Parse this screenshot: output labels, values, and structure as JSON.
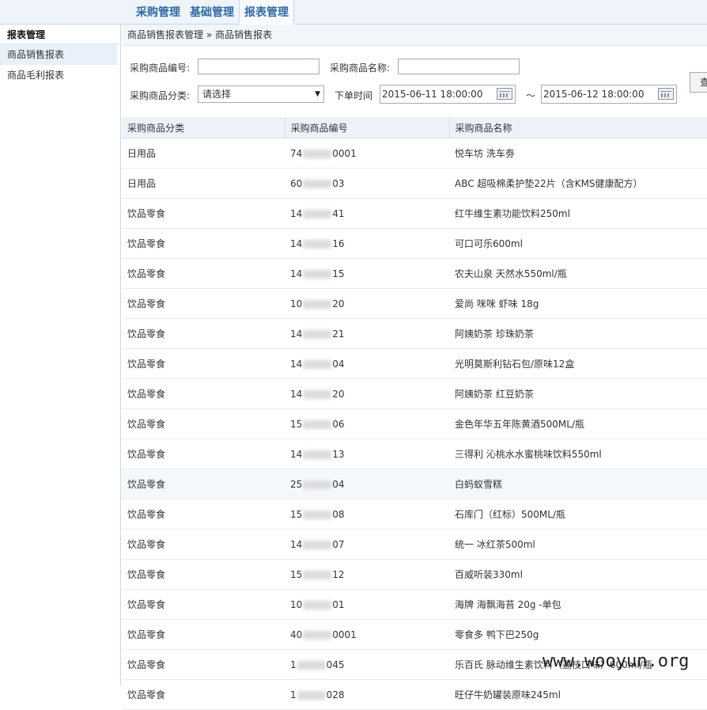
{
  "topnav": {
    "tabs": [
      {
        "label": "采购管理"
      },
      {
        "label": "基础管理"
      },
      {
        "label": "报表管理"
      }
    ]
  },
  "sidebar": {
    "title": "报表管理",
    "items": [
      {
        "label": "商品销售报表"
      },
      {
        "label": "商品毛利报表"
      }
    ]
  },
  "breadcrumb": "商品销售报表管理 » 商品销售报表",
  "form": {
    "code_label": "采购商品编号:",
    "code_value": "",
    "name_label": "采购商品名称:",
    "name_value": "",
    "category_label": "采购商品分类:",
    "category_value": "请选择",
    "time_label": "下单时间",
    "start_time": "2015-06-11 18:00:00",
    "tilde": "～",
    "end_time": "2015-06-12 18:00:00",
    "query_label": "查"
  },
  "table": {
    "headers": [
      "采购商品分类",
      "采购商品编号",
      "采购商品名称"
    ],
    "rows": [
      {
        "category": "日用品",
        "code_pre": "74",
        "code_suf": "0001",
        "name": "悦车坊 洗车劵"
      },
      {
        "category": "日用品",
        "code_pre": "60",
        "code_suf": "03",
        "name": "ABC 超吸棉柔护垫22片（含KMS健康配方）"
      },
      {
        "category": "饮品零食",
        "code_pre": "14",
        "code_suf": "41",
        "name": "红牛维生素功能饮料250ml"
      },
      {
        "category": "饮品零食",
        "code_pre": "14",
        "code_suf": "16",
        "name": "可口可乐600ml"
      },
      {
        "category": "饮品零食",
        "code_pre": "14",
        "code_suf": "15",
        "name": "农夫山泉 天然水550ml/瓶"
      },
      {
        "category": "饮品零食",
        "code_pre": "10",
        "code_suf": "20",
        "name": "爱尚 咪咪 虾味 18g"
      },
      {
        "category": "饮品零食",
        "code_pre": "14",
        "code_suf": "21",
        "name": "阿姨奶茶 珍珠奶茶"
      },
      {
        "category": "饮品零食",
        "code_pre": "14",
        "code_suf": "04",
        "name": "光明莫斯利钻石包/原味12盒"
      },
      {
        "category": "饮品零食",
        "code_pre": "14",
        "code_suf": "20",
        "name": "阿姨奶茶 红豆奶茶"
      },
      {
        "category": "饮品零食",
        "code_pre": "15",
        "code_suf": "06",
        "name": "金色年华五年陈黄酒500ML/瓶"
      },
      {
        "category": "饮品零食",
        "code_pre": "14",
        "code_suf": "13",
        "name": "三得利 沁桃水水蜜桃味饮料550ml"
      },
      {
        "category": "饮品零食",
        "code_pre": "25",
        "code_suf": "04",
        "name": "白蚂蚁雪糕"
      },
      {
        "category": "饮品零食",
        "code_pre": "15",
        "code_suf": "08",
        "name": "石库门（红标）500ML/瓶"
      },
      {
        "category": "饮品零食",
        "code_pre": "14",
        "code_suf": "07",
        "name": "统一 冰红茶500ml"
      },
      {
        "category": "饮品零食",
        "code_pre": "15",
        "code_suf": "12",
        "name": "百威听装330ml"
      },
      {
        "category": "饮品零食",
        "code_pre": "10",
        "code_suf": "01",
        "name": "海牌 海飘海苔 20g -单包"
      },
      {
        "category": "饮品零食",
        "code_pre": "40",
        "code_suf": "0001",
        "name": "零食多 鸭下巴250g"
      },
      {
        "category": "饮品零食",
        "code_pre": "1",
        "code_suf": "045",
        "name": "乐百氏 脉动维生素饮料（荔枝口味）600ml/瓶"
      },
      {
        "category": "饮品零食",
        "code_pre": "1",
        "code_suf": "028",
        "name": "旺仔牛奶罐装原味245ml"
      }
    ]
  },
  "watermark": "www.wooyun.org"
}
